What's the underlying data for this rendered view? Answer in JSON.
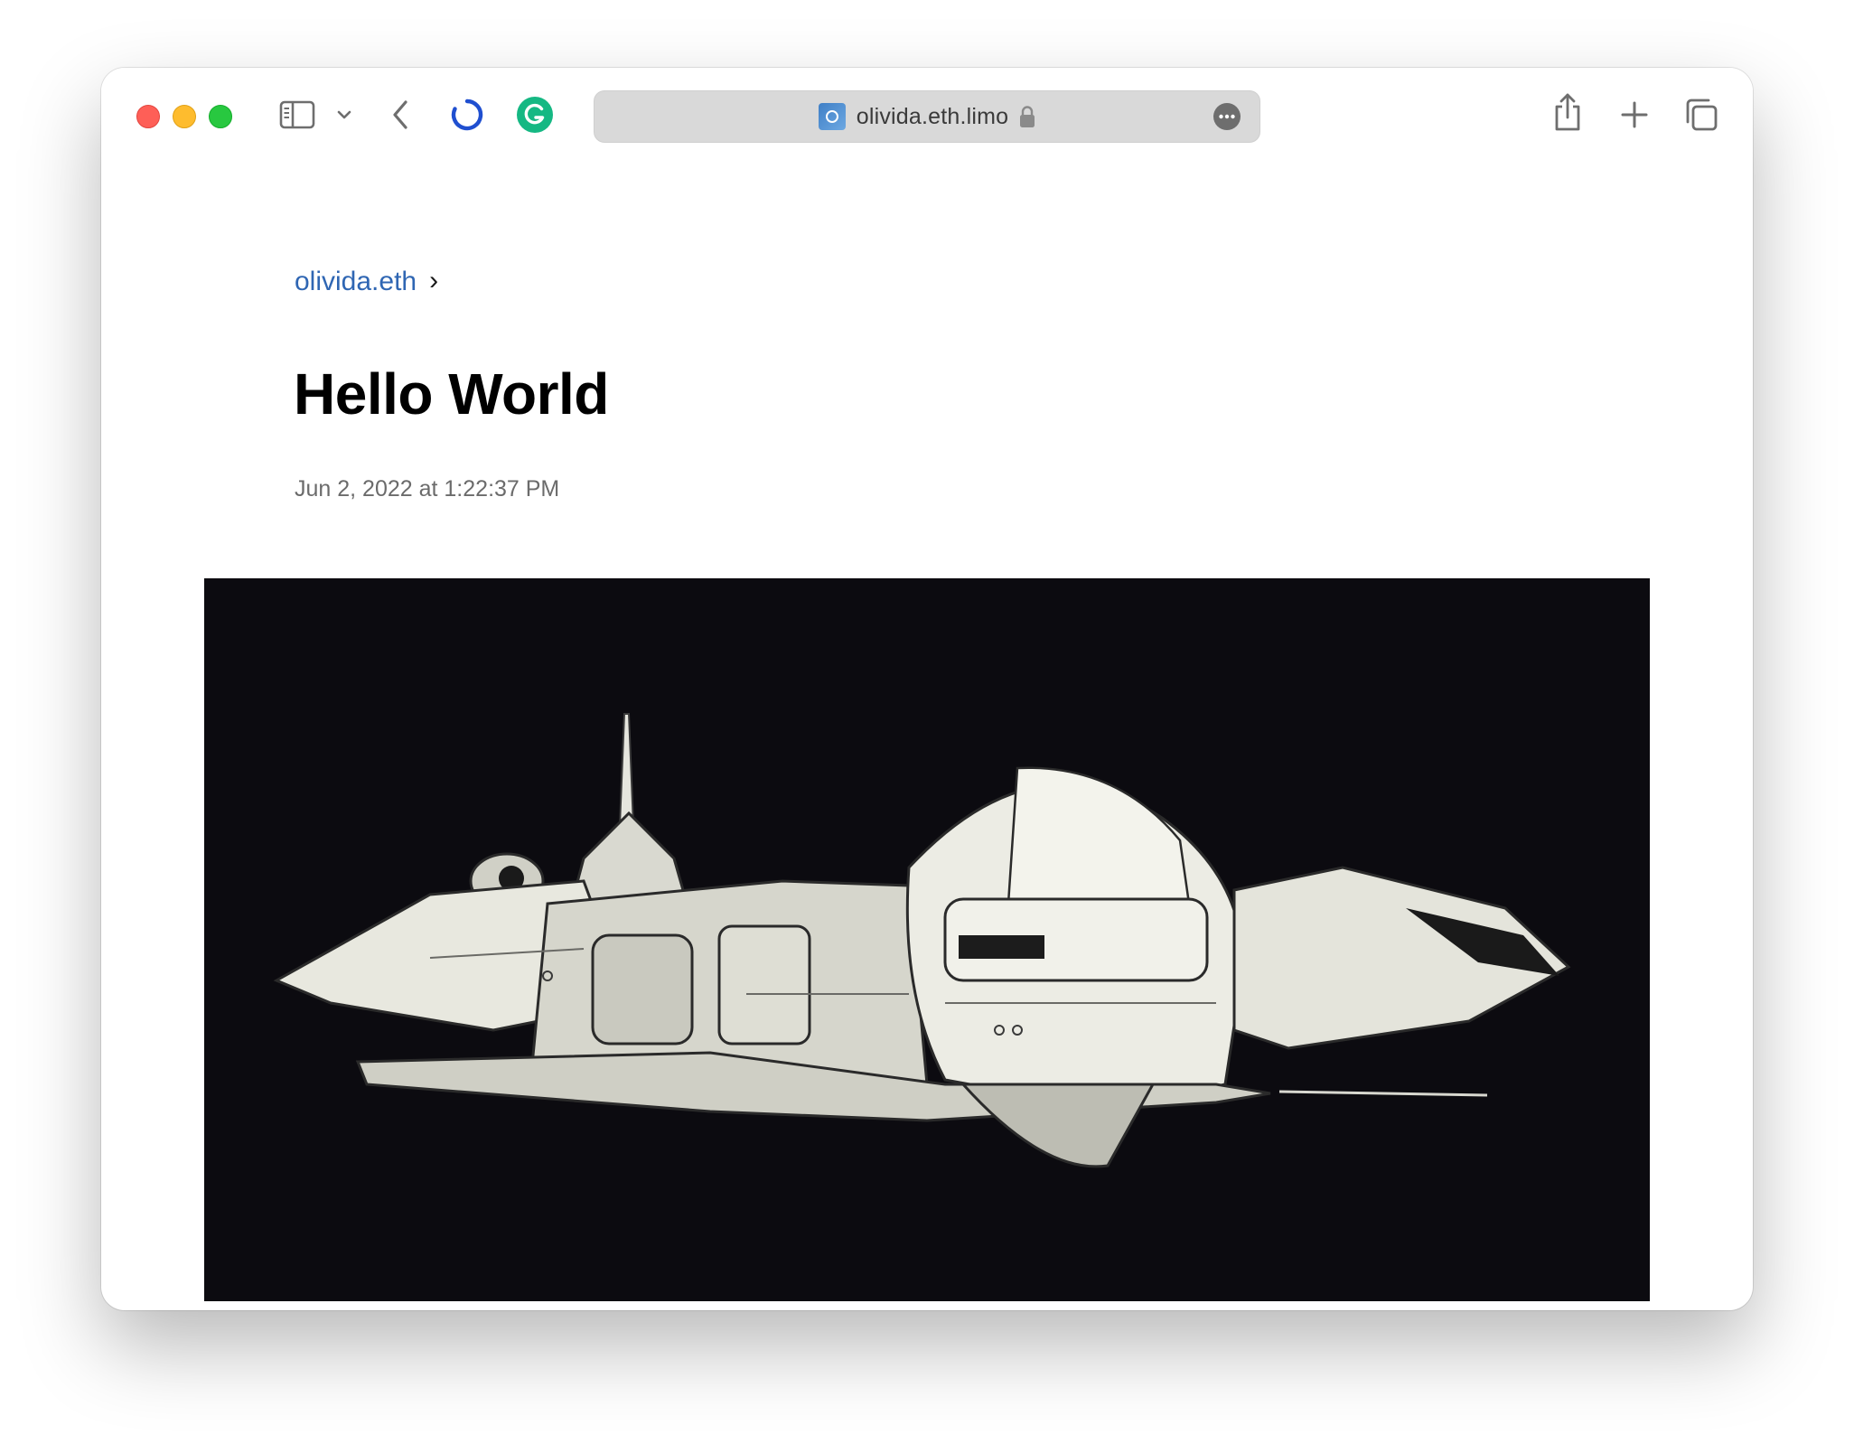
{
  "browser": {
    "address_bar": {
      "url": "olivida.eth.limo"
    },
    "icons": {
      "sidebar": "sidebar-icon",
      "sidebar_menu": "chevron-down-icon",
      "back": "chevron-left-icon",
      "loading": "loading-spinner-icon",
      "extension": "grammarly-icon",
      "secure": "lock-icon",
      "page_menu": "more-icon",
      "share": "share-icon",
      "new_tab": "plus-icon",
      "tabs": "tab-overview-icon"
    },
    "colors": {
      "accent_spinner": "#1f4fd0",
      "grammarly": "#15b883"
    }
  },
  "page": {
    "breadcrumb": {
      "link": "olivida.eth",
      "separator": "›"
    },
    "title": "Hello World",
    "date": "Jun 2, 2022 at 1:22:37 PM",
    "hero_image": {
      "subject": "spaceship illustration",
      "background_color": "#0c0b10"
    },
    "colors": {
      "link": "#2f66b3",
      "title": "#000000",
      "date": "#6b6b6b"
    }
  }
}
